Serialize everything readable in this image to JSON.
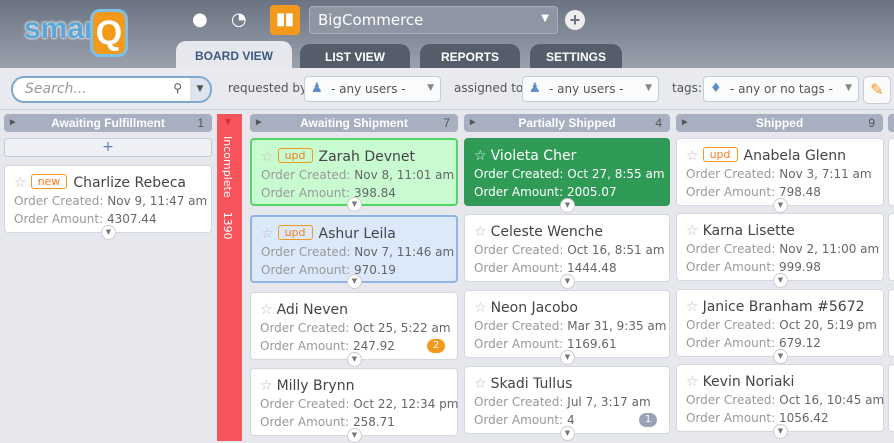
{
  "app": {
    "logo": "smartQ",
    "project": "BigCommerce"
  },
  "tabs": [
    {
      "label": "BOARD VIEW"
    },
    {
      "label": "LIST VIEW"
    },
    {
      "label": "REPORTS"
    },
    {
      "label": "SETTINGS"
    }
  ],
  "filters": {
    "search_placeholder": "Search...",
    "requested_label": "requested by:",
    "requested_value": "- any users -",
    "assigned_label": "assigned to:",
    "assigned_value": "- any users -",
    "tags_label": "tags:",
    "tags_value": "- any or no tags -"
  },
  "labels": {
    "created": "Order Created:",
    "amount": "Order Amount:",
    "add": "+"
  },
  "incomplete": {
    "label": "Incomplete",
    "count": "1390"
  },
  "columns": [
    {
      "title": "Awaiting Fulfillment",
      "count": "1",
      "cards": [
        {
          "badge": "new",
          "name": "Charlize Rebeca",
          "created": "Nov 9, 11:47 am",
          "amount": "4307.44"
        }
      ]
    },
    {
      "title": "Awaiting Shipment",
      "count": "7",
      "cards": [
        {
          "badge": "upd",
          "name": "Zarah Devnet",
          "created": "Nov 8, 11:01 am",
          "amount": "398.84",
          "style": "green"
        },
        {
          "badge": "upd",
          "name": "Ashur Leila",
          "created": "Nov 7, 11:46 am",
          "amount": "970.19",
          "style": "blue"
        },
        {
          "name": "Adi Neven",
          "created": "Oct 25, 5:22 am",
          "amount": "247.92",
          "comments": "2",
          "comment_color": "#f39a1c"
        },
        {
          "name": "Milly Brynn",
          "created": "Oct 22, 12:34 pm",
          "amount": "258.71"
        }
      ]
    },
    {
      "title": "Partially Shipped",
      "count": "4",
      "cards": [
        {
          "name": "Violeta Cher",
          "created": "Oct 27, 8:55 am",
          "amount": "2005.07",
          "style": "dark"
        },
        {
          "name": "Celeste Wenche",
          "created": "Oct 16, 8:51 am",
          "amount": "1444.48"
        },
        {
          "name": "Neon Jacobo",
          "created": "Mar 31, 9:35 am",
          "amount": "1169.61"
        },
        {
          "name": "Skadi Tullus",
          "created": "Jul 7, 3:17 am",
          "amount": "4",
          "comments": "1",
          "comment_color": "#9aa3b5"
        }
      ]
    },
    {
      "title": "Shipped",
      "count": "9",
      "cards": [
        {
          "badge": "upd",
          "name": "Anabela Glenn",
          "created": "Nov 3, 7:11 am",
          "amount": "798.48"
        },
        {
          "name": "Karna Lisette",
          "created": "Nov 2, 11:00 am",
          "amount": "999.98"
        },
        {
          "name": "Janice Branham #5672",
          "created": "Oct 20, 5:19 pm",
          "amount": "679.12"
        },
        {
          "name": "Kevin Noriaki",
          "created": "Oct 16, 10:45 am",
          "amount": "1056.42"
        }
      ]
    }
  ]
}
